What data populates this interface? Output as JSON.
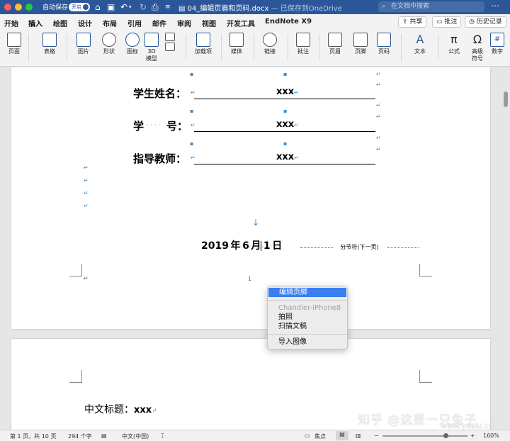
{
  "titlebar": {
    "autosave_label": "自动保存",
    "autosave_state": "开启",
    "document_name": "04_编辑页眉和页码.docx",
    "save_status": " — 已保存到OneDrive",
    "search_placeholder": "在文档中搜索"
  },
  "tabs": [
    "开始",
    "插入",
    "绘图",
    "设计",
    "布局",
    "引用",
    "邮件",
    "审阅",
    "视图",
    "开发工具",
    "EndNote X9"
  ],
  "active_tab": "插入",
  "tab_buttons": {
    "share": "共享",
    "comment": "批注",
    "history": "历史记录"
  },
  "ribbon": {
    "page": "页面",
    "table": "表格",
    "picture": "图片",
    "shapes": "形状",
    "icons": "图标",
    "model3d_line1": "3D",
    "model3d_line2": "模型",
    "addins": "加载项",
    "media": "媒体",
    "link": "链接",
    "comment": "批注",
    "header": "页眉",
    "footer": "页脚",
    "page_number": "页码",
    "textbox": "文本",
    "equation": "公式",
    "advanced_symbol_line1": "高级",
    "advanced_symbol_line2": "符号",
    "number": "数字"
  },
  "document": {
    "student_name_label": "学生姓名：",
    "student_id_label_1": "学",
    "student_id_label_2": "号：",
    "advisor_label": "指导教师：",
    "placeholder_value": "xxx",
    "date": {
      "year": "2019",
      "year_unit": "年",
      "month": "6",
      "month_unit": "月",
      "day": "1",
      "day_unit": "日"
    },
    "section_break": "分节符(下一页)",
    "page_number": "1",
    "page2_title": "中文标题：",
    "page2_title_value": "xxx"
  },
  "context_menu": {
    "items": [
      "编辑页脚",
      "Chandler-iPhone8",
      "拍照",
      "扫描文稿",
      "导入图像"
    ]
  },
  "statusbar": {
    "page_info": "第 1 页，共 10 页",
    "word_count": "294 个字",
    "language": "中文(中国)",
    "focus": "焦点",
    "zoom": "160%"
  },
  "watermark": {
    "text": "知乎 @这是一只兔子",
    "site": "www.yesiu.cn"
  },
  "colors": {
    "title_bar": "#2b579a",
    "menu_highlight": "#3a7ff0",
    "formatting_mark": "#3a8fd0"
  }
}
